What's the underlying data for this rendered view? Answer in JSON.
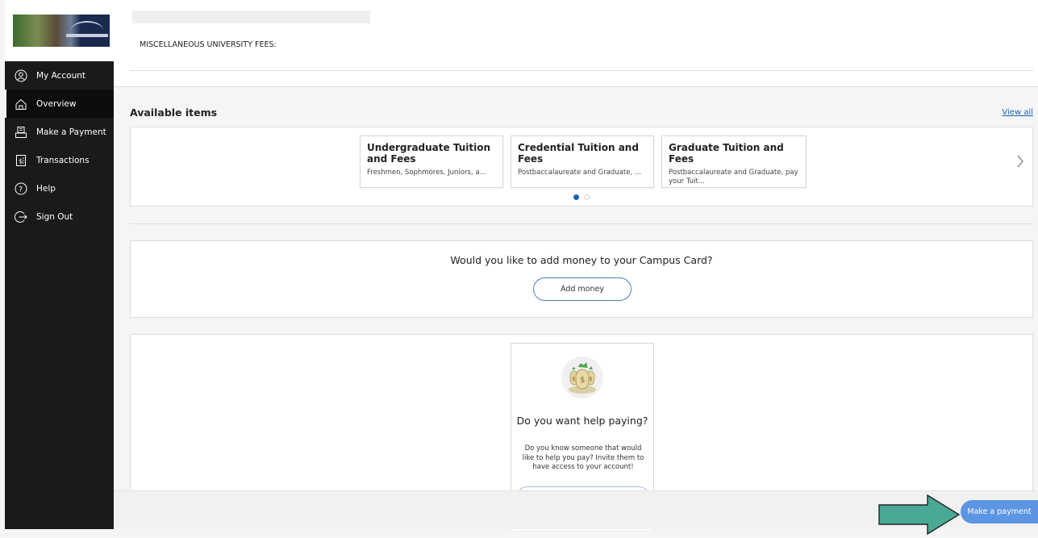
{
  "sidebar": {
    "items": [
      {
        "label": "My Account",
        "icon": "user-icon"
      },
      {
        "label": "Overview",
        "icon": "home-icon"
      },
      {
        "label": "Make a Payment",
        "icon": "payment-icon"
      },
      {
        "label": "Transactions",
        "icon": "receipt-icon"
      },
      {
        "label": "Help",
        "icon": "help-icon"
      },
      {
        "label": "Sign Out",
        "icon": "sign-out-icon"
      }
    ],
    "active": "Overview"
  },
  "header": {
    "fees_label": "MISCELLANEOUS UNIVERSITY FEES:"
  },
  "available": {
    "title": "Available items",
    "view_all": "View all",
    "items": [
      {
        "title": "Undergraduate Tuition and Fees",
        "desc": "Freshmen, Sophmores, Juniors, a..."
      },
      {
        "title": "Credential Tuition and Fees",
        "desc": "Postbaccalaureate and Graduate, ..."
      },
      {
        "title": "Graduate Tuition and Fees",
        "desc": "Postbaccalaureate and Graduate, pay your Tuit..."
      }
    ],
    "page": 1,
    "pages": 2
  },
  "campus": {
    "question": "Would you like to add money to your Campus Card?",
    "button": "Add money"
  },
  "help_paying": {
    "title": "Do you want help paying?",
    "desc": "Do you know someone that would like to help you pay? Invite them to have access to your account!"
  },
  "footer": {
    "pay_button": "Make a payment"
  },
  "colors": {
    "accent": "#1a62b8",
    "pay_button": "#5b95e3",
    "arrow": "#4aa896",
    "sidebar": "#1a1a1a"
  }
}
